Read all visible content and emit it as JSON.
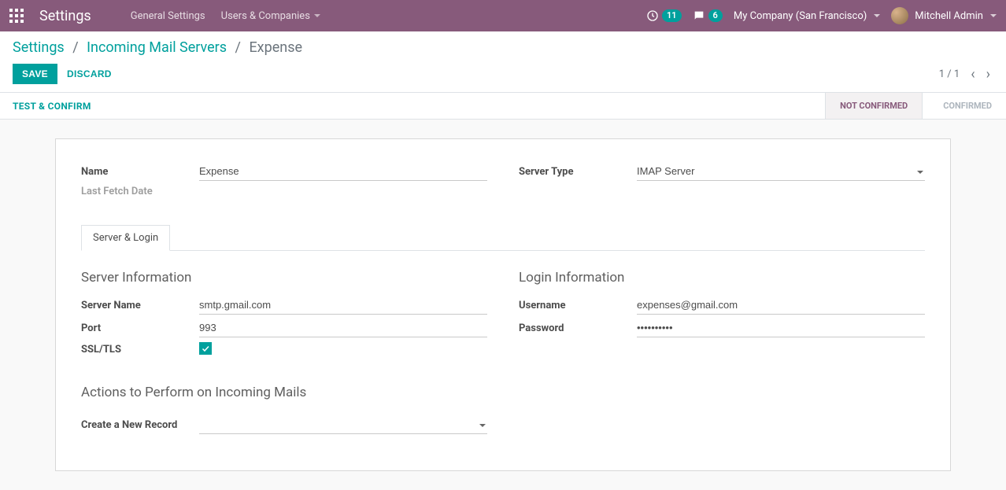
{
  "topbar": {
    "app_title": "Settings",
    "menu": {
      "general": "General Settings",
      "users": "Users & Companies"
    },
    "activities_count": "11",
    "messages_count": "6",
    "company": "My Company (San Francisco)",
    "user": "Mitchell Admin"
  },
  "breadcrumb": {
    "root": "Settings",
    "parent": "Incoming Mail Servers",
    "current": "Expense"
  },
  "buttons": {
    "save": "SAVE",
    "discard": "DISCARD",
    "test_confirm": "TEST & CONFIRM"
  },
  "pager": {
    "text": "1 / 1"
  },
  "status": {
    "not_confirmed": "NOT CONFIRMED",
    "confirmed": "CONFIRMED"
  },
  "form": {
    "labels": {
      "name": "Name",
      "last_fetch": "Last Fetch Date",
      "server_type": "Server Type"
    },
    "values": {
      "name": "Expense",
      "server_type": "IMAP Server"
    },
    "tabs": {
      "server_login": "Server & Login"
    },
    "server_info": {
      "title": "Server Information",
      "server_name_label": "Server Name",
      "server_name": "smtp.gmail.com",
      "port_label": "Port",
      "port": "993",
      "ssl_label": "SSL/TLS",
      "ssl_checked": true
    },
    "login_info": {
      "title": "Login Information",
      "username_label": "Username",
      "username": "expenses@gmail.com",
      "password_label": "Password",
      "password": "••••••••••"
    },
    "actions": {
      "title": "Actions to Perform on Incoming Mails",
      "create_record_label": "Create a New Record"
    }
  }
}
